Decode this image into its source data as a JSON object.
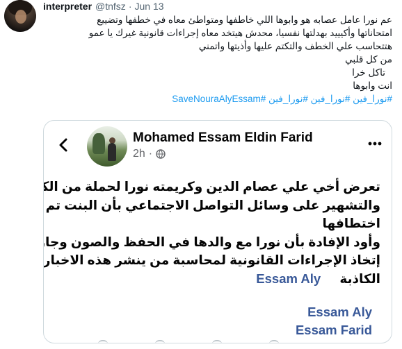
{
  "tweet": {
    "author_name": "interpreter",
    "author_handle": "@tnfsz",
    "separator": "·",
    "date": "Jun 13",
    "lines": [
      "عم نورا عامل عصابه هو وابوها اللي خاطفها ومتواطئ معاه في خطفها وتضييع",
      "امتحاناتها وأكيييد بهدلتها نفسيا، محدش هيتخد معاه إجراءات قانونية غيرك يا عمو",
      "هتتحاسب علي الخطف والتكتم عليها وأذيتها واتمني",
      "من كل قلبي",
      "تاكل خرا",
      "انت وابوها"
    ],
    "hashtags": "#نورا_فين #نورا_فين #نورا_فين #SaveNouraAlyEssam"
  },
  "embedded_post": {
    "author_name": "Mohamed Essam Eldin Farid",
    "time": "2h",
    "meta_separator": "·",
    "lines": [
      "تعرض أخي علي عصام الدين  وكريمته نورا لحملة من الكذب",
      "والتشهير على وسائل التواصل الاجتماعي بأن البنت تم",
      "اختطافها",
      "وأود الإفادة بأن نورا مع والدها في الحفظ والصون وجاري",
      "إتخاذ الإجراءات القانونية لمحاسبة من ينشر هذه الاخبار"
    ],
    "last_line_text": "الكاذبة",
    "last_line_link": "Essam Aly",
    "links": [
      "Essam Aly",
      "Essam Farid"
    ],
    "icons": {
      "back": "back-arrow-icon",
      "privacy": "globe-icon",
      "menu": "more-dots-icon"
    }
  },
  "colors": {
    "hashtag": "#1d9bf0",
    "fb_link": "#385898",
    "muted": "#536471",
    "card_border": "#cfd9de"
  }
}
